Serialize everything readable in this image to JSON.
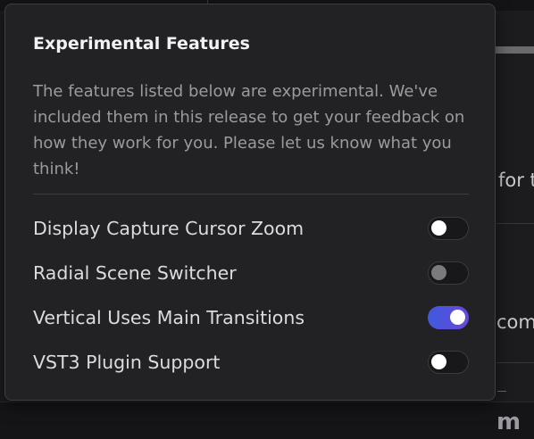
{
  "background": {
    "partial_text_1": "for t",
    "partial_text_2": "com",
    "logo_text": "m"
  },
  "panel": {
    "title": "Experimental Features",
    "description": "The features listed below are experimental. We've included them in this release to get your feedback on how they work for you. Please let us know what you think!",
    "features": [
      {
        "label": "Display Capture Cursor Zoom",
        "state": "off",
        "enabled": true
      },
      {
        "label": "Radial Scene Switcher",
        "state": "off",
        "enabled": false
      },
      {
        "label": "Vertical Uses Main Transitions",
        "state": "on",
        "enabled": true
      },
      {
        "label": "VST3 Plugin Support",
        "state": "off",
        "enabled": true
      }
    ]
  },
  "colors": {
    "toggle_on": "#4a55e0",
    "panel_bg": "#222224",
    "text_primary": "#dcdce0",
    "text_secondary": "#9a9aa0"
  }
}
